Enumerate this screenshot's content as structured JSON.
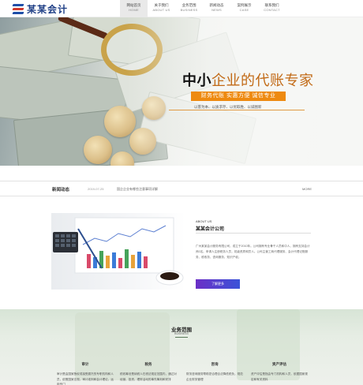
{
  "header": {
    "logo_text": "某某会计",
    "nav": [
      {
        "cn": "网站首页",
        "en": "HOME",
        "active": true
      },
      {
        "cn": "关于我们",
        "en": "ABOUT US",
        "active": false
      },
      {
        "cn": "业务范围",
        "en": "BUSINESS",
        "active": false
      },
      {
        "cn": "新闻动态",
        "en": "NEWS",
        "active": false
      },
      {
        "cn": "案例展示",
        "en": "CASE",
        "active": false
      },
      {
        "cn": "联系我们",
        "en": "CONTACT",
        "active": false
      }
    ]
  },
  "hero": {
    "title_bold": "中小",
    "title_rest": "企业的代账专家",
    "tagline": "财务代账  实惠方便  诚信专业",
    "subline": "以客为本、以质求存、以优取胜、以诚图新",
    "colors": {
      "accent": "#ee8a10",
      "title_rest": "#c26a16"
    }
  },
  "news": {
    "label": "新闻动态",
    "date": "2019-07-25",
    "headline": "国企企业有哪些注意事项详解",
    "more": "MORE"
  },
  "about": {
    "en_label": "ABOUT US",
    "title": "某某会计公司",
    "body": "广州某某会计服务有限公司，成立于2010年。公司拥有专业骨干人员和中人，拥有支持会计师2名。申请人注册税务人员，初级资质和员人。公司主营工商代理服务、会计代理记账服务、税收务、咨询服务、知识产权。",
    "button_label": "了解更多",
    "colors": {
      "button_from": "#6b2fc6",
      "button_to": "#3b53d8"
    }
  },
  "services": {
    "title": "业务范围",
    "subtitle": "BUSINESS",
    "items": [
      {
        "name": "审计",
        "desc": "审计是由国家授权或接受委托的专职机构和人员，依照国家法规、审计准则和会计理论，运用专门"
      },
      {
        "name": "税务",
        "desc": "税收筹划是纳税人在税法规定范围内，通过对经营、投资、理财活动的事先筹划和安排"
      },
      {
        "name": "咨询",
        "desc": "财务咨询服务帮助您合理合法降低税负，规范企业财务管理"
      },
      {
        "name": "资产评估",
        "desc": "资产评估是指由专门机构和人员，依据国家规定和有关资料"
      }
    ]
  }
}
